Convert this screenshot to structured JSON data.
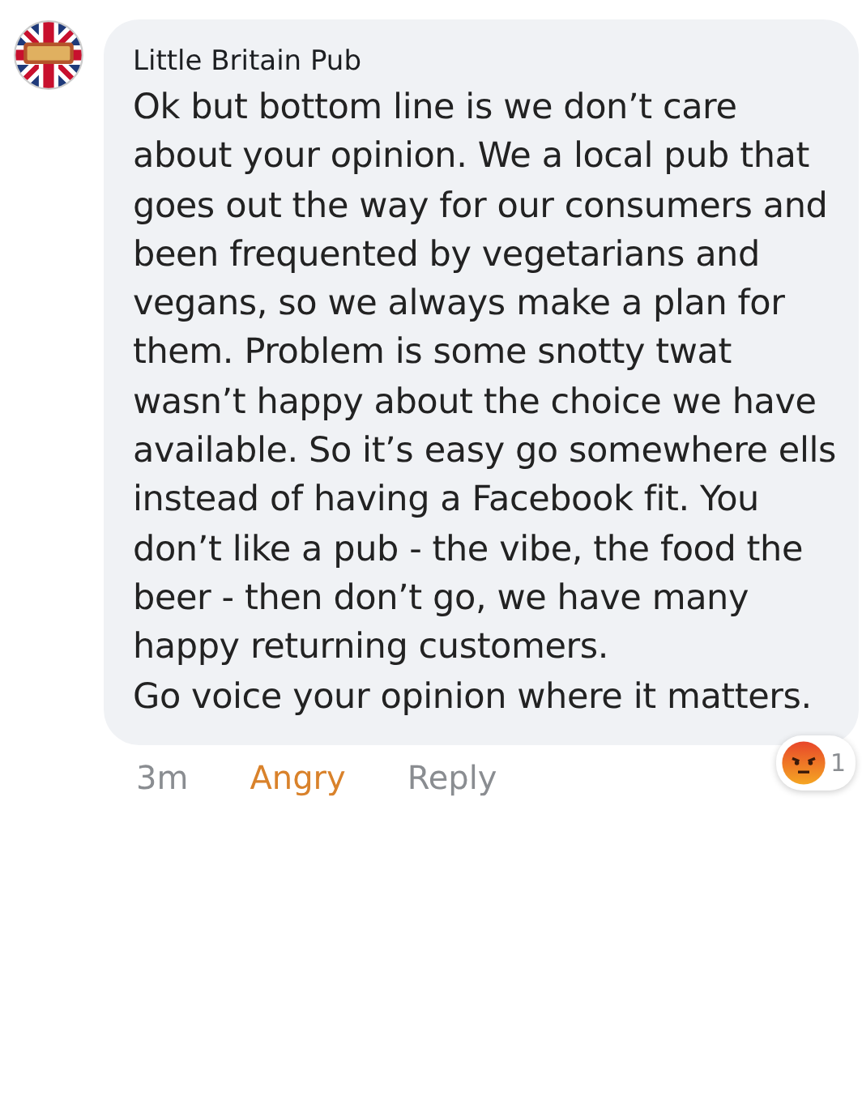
{
  "comment": {
    "author": "Little Britain Pub",
    "paragraphs": [
      "Ok but bottom line is we don’t care about your opinion. We a local pub that goes out the way for our consumers and been frequented by vegetarians and vegans, so we always make a plan for them. Problem is some snotty twat wasn’t happy about the choice we have available. So it’s easy go somewhere ells instead of having a Facebook fit. You don’t like a pub - the vibe, the food the beer - then don’t go, we have many happy returning customers.",
      "Go voice your opinion where it matters."
    ],
    "time": "3m",
    "reaction_label": "Angry",
    "reaction_active": true,
    "reply": "Reply",
    "reaction_badge": {
      "kind": "angry",
      "count": "1"
    }
  }
}
